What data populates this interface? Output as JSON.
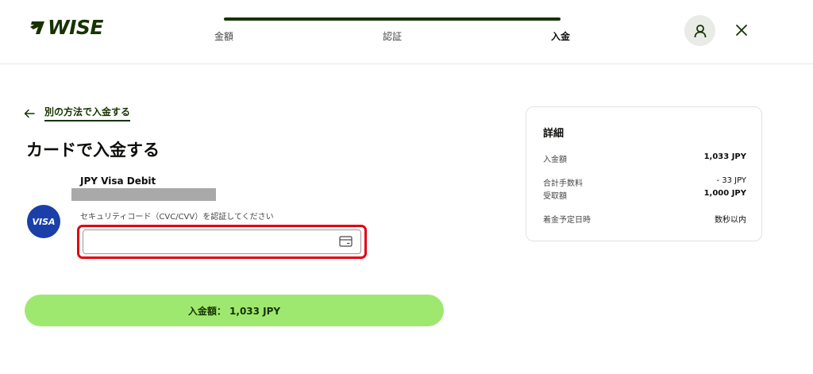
{
  "header": {
    "logo_text": "WISE",
    "steps": [
      {
        "label": "金額",
        "active": false
      },
      {
        "label": "認証",
        "active": false
      },
      {
        "label": "入金",
        "active": true
      }
    ]
  },
  "back_link": {
    "label": "別の方法で入金する"
  },
  "page_title": "カードで入金する",
  "card": {
    "brand_badge": "VISA",
    "name": "JPY Visa Debit",
    "cvc_label": "セキュリティコード（CVC/CVV）を認証してください",
    "cvc_value": "",
    "cvc_placeholder": ""
  },
  "pay_button": {
    "label": "入金額： 1,033 JPY"
  },
  "details": {
    "title": "詳細",
    "rows": [
      {
        "label": "入金額",
        "value": "1,033 JPY"
      },
      {
        "label": "合計手数料",
        "value": "- 33 JPY"
      },
      {
        "label": "受取額",
        "value": "1,000 JPY"
      },
      {
        "label": "着金予定日時",
        "value": "数秒以内"
      }
    ]
  },
  "colors": {
    "brand_dark_green": "#163300",
    "brand_bright_green": "#9fe870",
    "visa_blue": "#1a3fa8",
    "highlight_red": "#e3000f"
  },
  "icons": [
    "wise-flag-icon",
    "user-icon",
    "close-icon",
    "arrow-left-icon",
    "card-icon"
  ]
}
